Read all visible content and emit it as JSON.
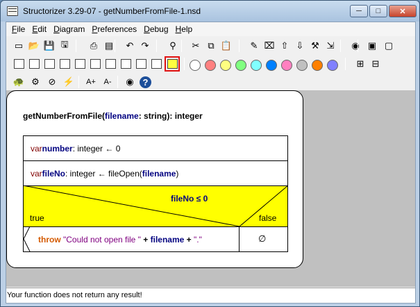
{
  "window": {
    "title": "Structorizer 3.29-07 - getNumberFromFile-1.nsd",
    "minimize_glyph": "─",
    "maximize_glyph": "□",
    "close_glyph": "✕"
  },
  "menu": [
    {
      "label": "File",
      "u": "F",
      "rest": "ile"
    },
    {
      "label": "Edit",
      "u": "E",
      "rest": "dit"
    },
    {
      "label": "Diagram",
      "u": "D",
      "rest": "iagram"
    },
    {
      "label": "Preferences",
      "u": "P",
      "rest": "references"
    },
    {
      "label": "Debug",
      "u": "D",
      "rest": "ebug"
    },
    {
      "label": "Help",
      "u": "H",
      "rest": "elp"
    }
  ],
  "toolbar": {
    "row1_icons": [
      "new-icon",
      "open-icon",
      "save-icon",
      "save-as-icon",
      "print-icon",
      "export-picture-icon",
      "undo-icon",
      "redo-icon",
      "find-icon",
      "cut-icon",
      "copy-icon",
      "paste-icon",
      "edit-element-icon",
      "delete-icon",
      "move-up-icon",
      "move-down-icon",
      "transmute-icon",
      "outsource-icon",
      "breakpoint-icon",
      "collapse-icon",
      "expand-icon"
    ],
    "row2_icons": [
      "add-instruction-icon",
      "add-if-icon",
      "add-case-icon",
      "add-for-icon",
      "add-while-icon",
      "add-repeat-icon",
      "add-forever-icon",
      "add-call-icon",
      "add-jump-icon",
      "add-parallel-icon",
      "add-try-icon"
    ],
    "colors": [
      "#ffffff",
      "#ff8080",
      "#ffff80",
      "#80ff80",
      "#80ffff",
      "#0080ff",
      "#ff80c0",
      "#c0c0c0",
      "#ff8000",
      "#8080ff"
    ],
    "row3_icons": [
      "turtle-icon",
      "executor-icon",
      "analyser-off-icon",
      "nice-icon",
      "font-up-icon",
      "font-down-icon",
      "eye-icon",
      "help-icon"
    ],
    "font_up_label": "A+",
    "font_down_label": "A-"
  },
  "diagram": {
    "signature": {
      "name": "getNumberFromFile(",
      "param": "filename",
      "param_type": ": string): integer"
    },
    "block1": {
      "kw": "var ",
      "var": "number",
      "rest": ": integer ← 0"
    },
    "block2": {
      "kw": "var ",
      "var": "fileNo",
      "rest1": ": integer ← fileOpen(",
      "arg": "filename",
      "rest2": ")"
    },
    "alternative": {
      "cond_var": "fileNo",
      "cond_rest": " ≤ 0",
      "true_label": "true",
      "false_label": "false",
      "fill": "#ffff00"
    },
    "throw": {
      "kw": "throw",
      "str1": " \"Could not open file \"",
      "plus1": " + ",
      "var": "filename",
      "plus2": " + ",
      "str2": "\".\""
    },
    "empty_branch": "∅"
  },
  "status": {
    "message": "Your function does not return any result!"
  }
}
